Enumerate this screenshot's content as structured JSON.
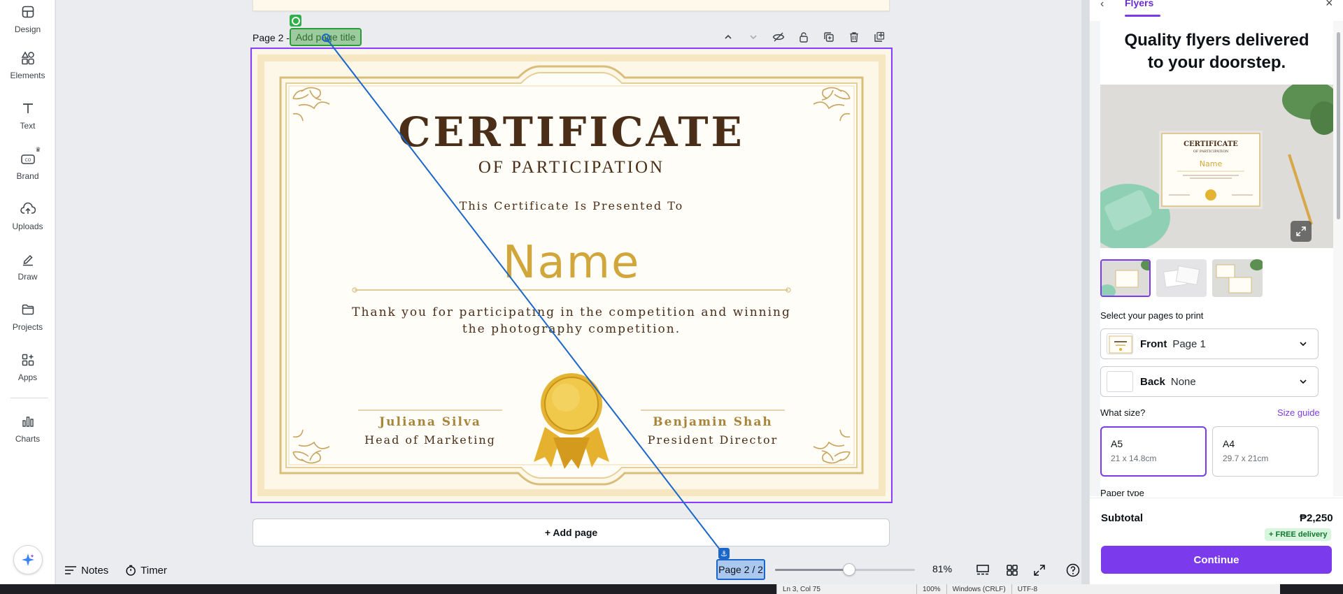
{
  "sidebar": {
    "items": [
      {
        "label": "Design",
        "icon": "design-icon"
      },
      {
        "label": "Elements",
        "icon": "elements-icon"
      },
      {
        "label": "Text",
        "icon": "text-icon"
      },
      {
        "label": "Brand",
        "icon": "brand-icon"
      },
      {
        "label": "Uploads",
        "icon": "uploads-icon"
      },
      {
        "label": "Draw",
        "icon": "draw-icon"
      },
      {
        "label": "Projects",
        "icon": "projects-icon"
      },
      {
        "label": "Apps",
        "icon": "apps-icon"
      },
      {
        "label": "Charts",
        "icon": "charts-icon"
      }
    ]
  },
  "editor": {
    "page_label": "Page 2 -",
    "page_title_placeholder": "Add page title",
    "add_page_label": "+ Add page",
    "page_counter": "Page 2 / 2",
    "zoom": "81%",
    "zoom_level": 0.53,
    "notes_label": "Notes",
    "timer_label": "Timer"
  },
  "certificate": {
    "title": "CERTIFICATE",
    "subtitle": "OF PARTICIPATION",
    "presented": "This Certificate Is Presented To",
    "name": "Name",
    "body_line1": "Thank you for participating in the competition and winning",
    "body_line2": "the photography competition.",
    "signer1_name": "Juliana Silva",
    "signer1_role": "Head of Marketing",
    "signer2_name": "Benjamin Shah",
    "signer2_role": "President Director"
  },
  "panel": {
    "tab": "Flyers",
    "headline_line1": "Quality flyers delivered",
    "headline_line2": "to your doorstep.",
    "mock_title": "CERTIFICATE",
    "mock_sub": "OF PARTICIPATION",
    "mock_name": "Name",
    "select_pages_label": "Select your pages to print",
    "front_key": "Front",
    "front_value": "Page 1",
    "back_key": "Back",
    "back_value": "None",
    "size_label": "What size?",
    "size_guide": "Size guide",
    "sizes": [
      {
        "name": "A5",
        "dims": "21 x 14.8cm"
      },
      {
        "name": "A4",
        "dims": "29.7 x 21cm"
      }
    ],
    "paper_type_label": "Paper type",
    "subtotal_label": "Subtotal",
    "subtotal_value": "₱2,250",
    "free_delivery": "+ FREE delivery",
    "continue_label": "Continue"
  },
  "statusbar": {
    "position": "Ln 3, Col 75",
    "zoom": "100%",
    "line_ending": "Windows (CRLF)",
    "encoding": "UTF-8"
  },
  "colors": {
    "accent": "#7c3aed",
    "gold": "#d1a73b",
    "brown": "#4a2e18",
    "selection_blue": "#1a66c9",
    "selection_green": "#2db04a"
  }
}
